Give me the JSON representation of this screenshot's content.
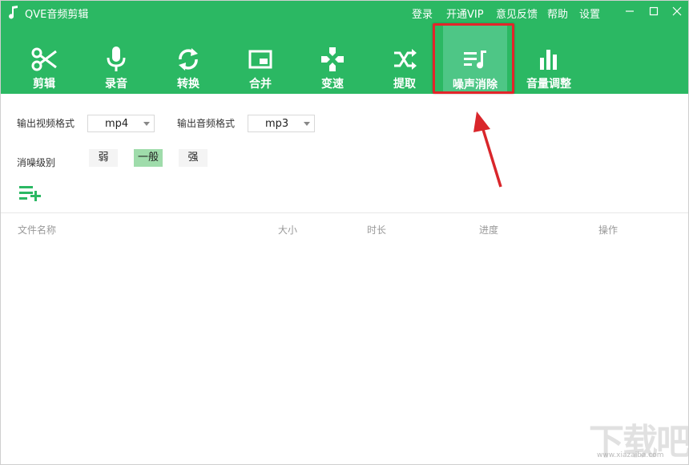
{
  "app": {
    "title": "QVE音频剪辑",
    "top_links": [
      "登录",
      "开通VIP",
      "意见反馈",
      "帮助",
      "设置"
    ]
  },
  "toolbar": {
    "items": [
      {
        "label": "剪辑",
        "icon": "scissors-icon"
      },
      {
        "label": "录音",
        "icon": "microphone-icon"
      },
      {
        "label": "转换",
        "icon": "refresh-icon"
      },
      {
        "label": "合并",
        "icon": "picture-in-picture-icon"
      },
      {
        "label": "变速",
        "icon": "dpad-icon"
      },
      {
        "label": "提取",
        "icon": "shuffle-icon"
      },
      {
        "label": "噪声消除",
        "icon": "playlist-note-icon"
      },
      {
        "label": "音量调整",
        "icon": "bar-chart-icon"
      }
    ],
    "active": "噪声消除"
  },
  "settings": {
    "video_format_label": "输出视频格式",
    "video_format_value": "mp4",
    "audio_format_label": "输出音频格式",
    "audio_format_value": "mp3",
    "denoise_level_label": "消噪级别",
    "levels": [
      "弱",
      "一般",
      "强"
    ],
    "selected_level": "一般"
  },
  "file_table": {
    "columns": [
      "文件名称",
      "大小",
      "时长",
      "进度",
      "操作"
    ],
    "rows": []
  },
  "watermark": {
    "text": "下载吧",
    "url": "www.xiazaiba.com"
  },
  "colors": {
    "header_green": "#2bb863",
    "active_tile": "#4ec686",
    "highlight_red": "#e3252a",
    "selected_level": "#9fdcab"
  }
}
